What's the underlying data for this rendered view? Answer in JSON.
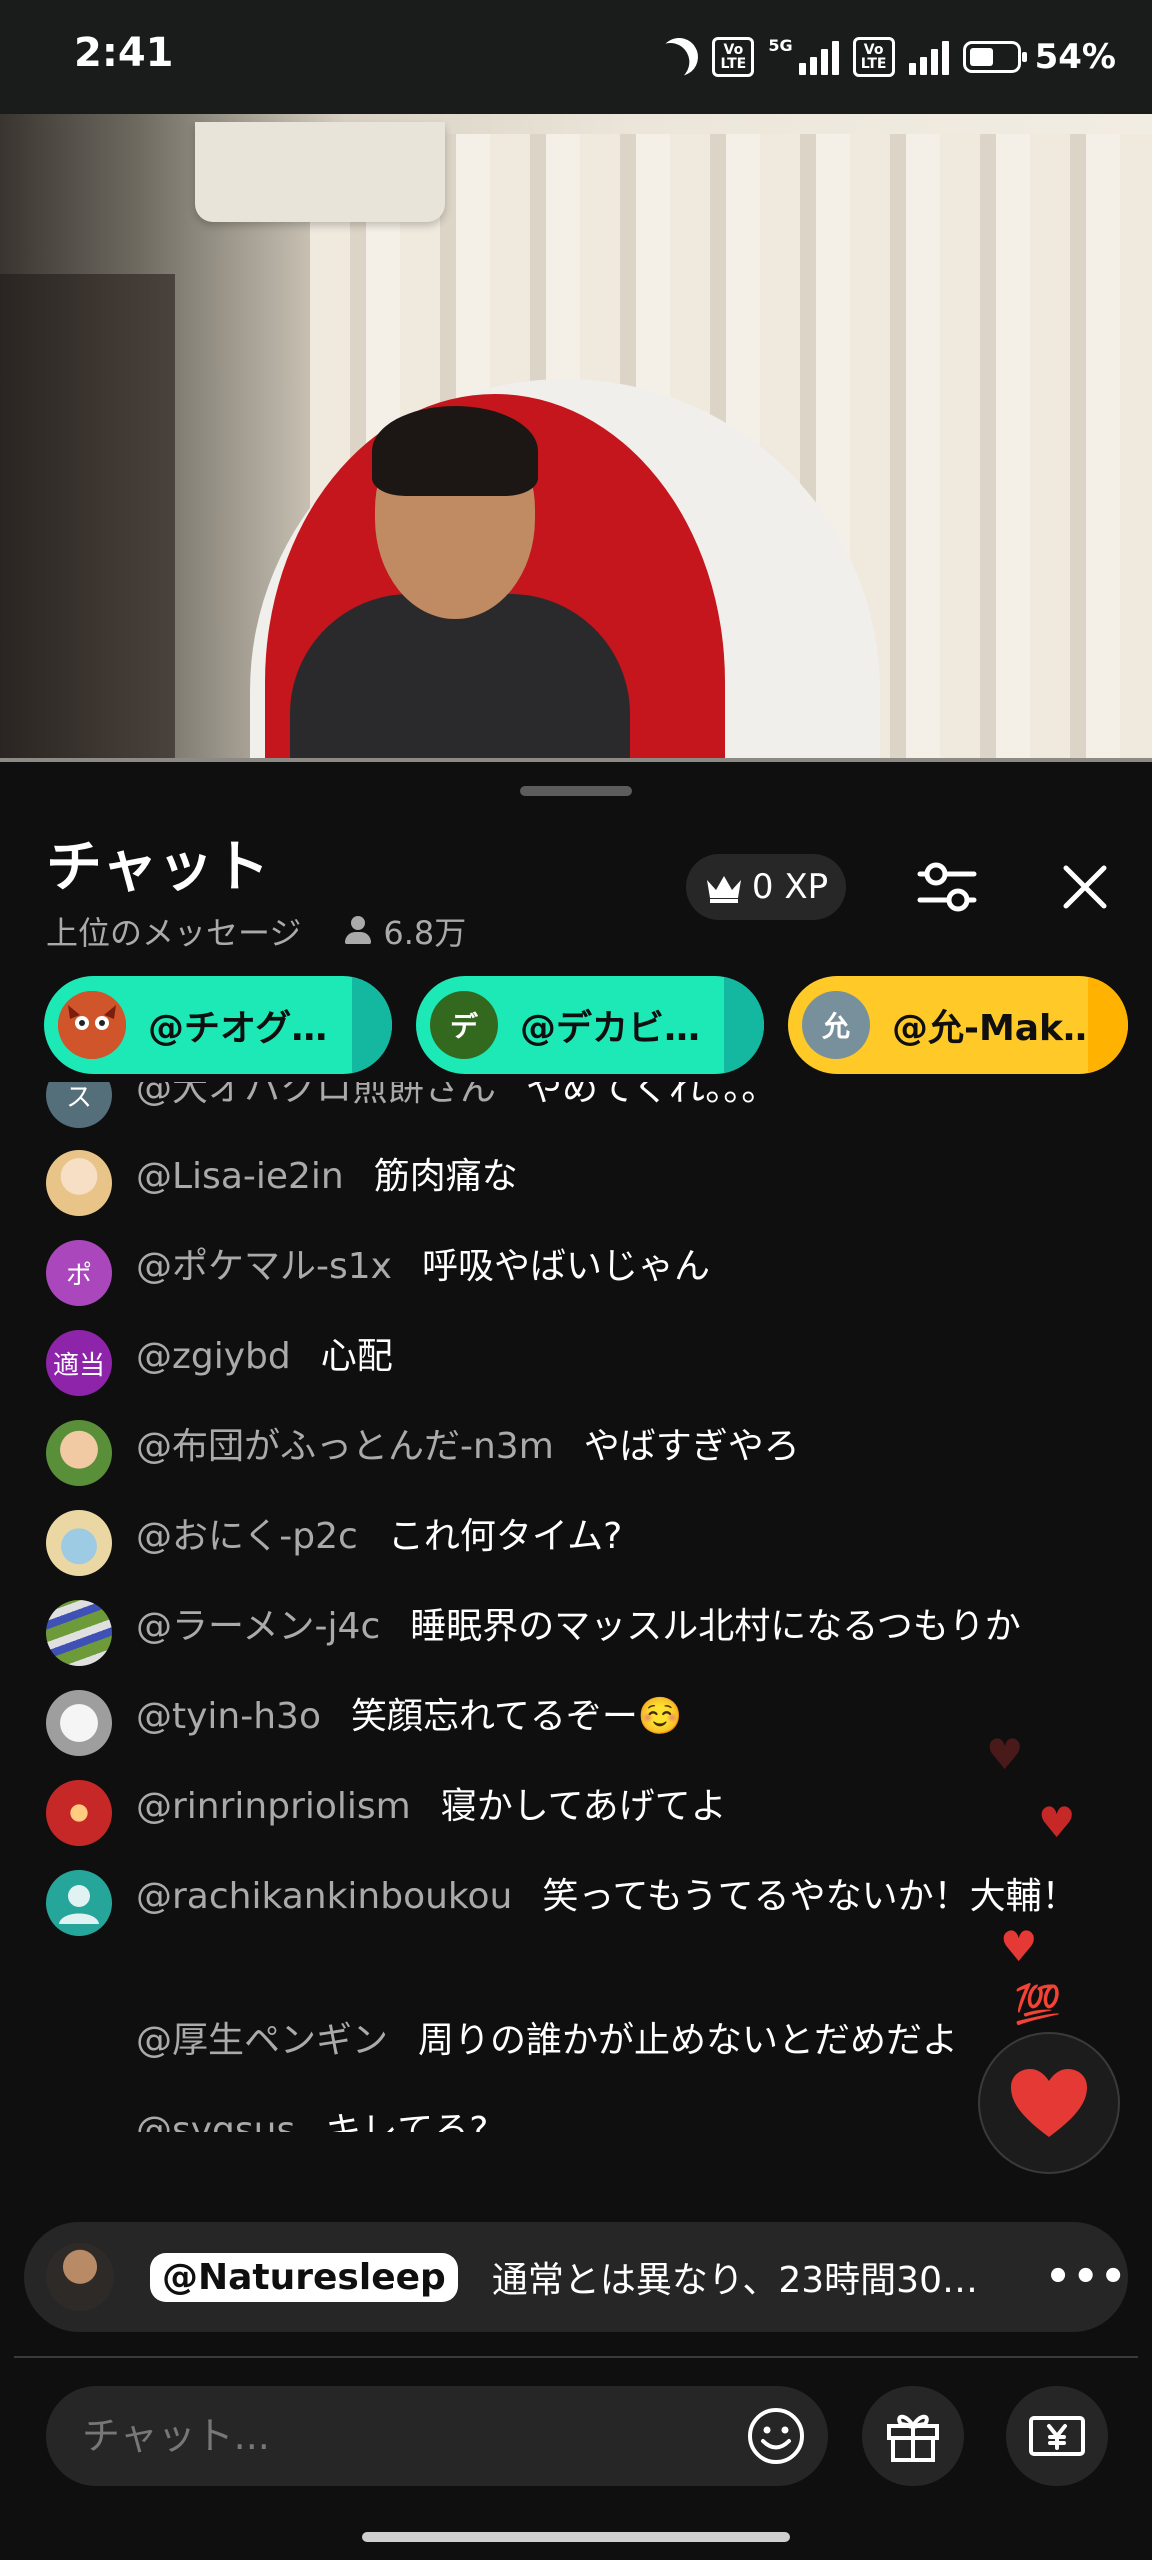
{
  "status_bar": {
    "time": "2:41",
    "volte1": "Vo\nLTE",
    "net": "5G",
    "battery_pct": "54%",
    "battery_level": 0.54
  },
  "chat": {
    "title": "チャット",
    "subtitle": "上位のメッセージ",
    "viewers": "6.8万",
    "xp": "0 XP",
    "chips": [
      {
        "label": "@チオグ…",
        "avatar_text": "",
        "color": "#1de9b6"
      },
      {
        "label": "@デカビ…",
        "avatar_text": "デ",
        "color": "#1de9b6"
      },
      {
        "label": "@允-Mak…",
        "avatar_text": "允",
        "color": "#ffca28"
      }
    ],
    "messages": [
      {
        "avatar_text": "ス",
        "avatar_color": "#546e7a",
        "author": "@大オハクロ煎餅さん",
        "text": "やめてくれ。。。"
      },
      {
        "avatar_text": "",
        "avatar_color": "#f0d9a0",
        "author": "@Lisa-ie2in",
        "text": "筋肉痛な"
      },
      {
        "avatar_text": "ポ",
        "avatar_color": "#ab47bc",
        "author": "@ポケマル-s1x",
        "text": "呼吸やばいじゃん"
      },
      {
        "avatar_text": "適当",
        "avatar_color": "#8e24aa",
        "author": "@zgiybd",
        "text": "心配"
      },
      {
        "avatar_text": "",
        "avatar_color": "#4caf50",
        "author": "@布団がふっとんだ-n3m",
        "text": "やばすぎやろ"
      },
      {
        "avatar_text": "",
        "avatar_color": "#e0c98a",
        "author": "@おにく-p2c",
        "text": "これ何タイム?"
      },
      {
        "avatar_text": "",
        "avatar_color": "#7cb342",
        "author": "@ラーメン-j4c",
        "text": "睡眠界のマッスル北村になるつもりか"
      },
      {
        "avatar_text": "",
        "avatar_color": "#bdbdbd",
        "author": "@tyin-h3o",
        "text": "笑顔忘れてるぞー☺️"
      },
      {
        "avatar_text": "",
        "avatar_color": "#c62828",
        "author": "@rinrinpriolism",
        "text": "寝かしてあげてよ"
      },
      {
        "avatar_text": "",
        "avatar_color": "#26a69a",
        "author": "@rachikankinboukou",
        "text": "笑ってもうてるやないか！大輔！"
      },
      {
        "avatar_text": "",
        "avatar_color": "",
        "author": "@厚生ペンギン",
        "text": "周りの誰かが止めないとだめだよ"
      },
      {
        "avatar_text": "",
        "avatar_color": "",
        "author": "@sygsus",
        "text": "キレてる?"
      }
    ],
    "pinned": {
      "author": "@Naturesleep",
      "text": "通常とは異なり、23時間30…",
      "more": "•••"
    },
    "input_placeholder": "チャット...",
    "hundred_emoji": "💯",
    "heart": "❤️"
  }
}
